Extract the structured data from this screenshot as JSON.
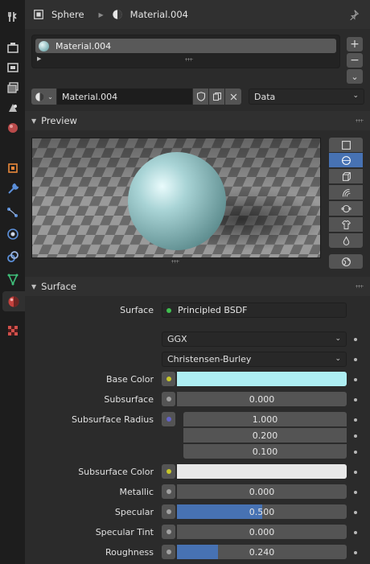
{
  "header": {
    "object_name": "Sphere",
    "material_name": "Material.004"
  },
  "slots": {
    "items": [
      "Material.004"
    ],
    "add_label": "+",
    "remove_label": "−",
    "more_label": "⌄"
  },
  "id_block": {
    "material_name": "Material.004",
    "link_mode": "Data"
  },
  "preview": {
    "title": "Preview",
    "shapes": [
      "plane-icon",
      "sphere-icon",
      "cube-icon",
      "hair-icon",
      "monkey-icon",
      "cloth-icon",
      "fluid-icon"
    ],
    "active_shape": "sphere-icon",
    "sphere_color": "#a9d4d6"
  },
  "surface": {
    "title": "Surface",
    "surface_label": "Surface",
    "shader": "Principled BSDF",
    "distribution": "GGX",
    "subsurface_method": "Christensen-Burley",
    "rows": [
      {
        "label": "Base Color",
        "type": "color",
        "socket": "#c7c729",
        "color": "#aeeef2"
      },
      {
        "label": "Subsurface",
        "type": "value",
        "socket": "#a1a1a1",
        "value": "0.000",
        "fraction": 0
      },
      {
        "label": "Subsurface Radius",
        "type": "vector",
        "socket": "#6363c7",
        "values": [
          "1.000",
          "0.200",
          "0.100"
        ]
      },
      {
        "label": "Subsurface Color",
        "type": "color",
        "socket": "#c7c729",
        "color": "#e8e8e8"
      },
      {
        "label": "Metallic",
        "type": "value",
        "socket": "#a1a1a1",
        "value": "0.000",
        "fraction": 0
      },
      {
        "label": "Specular",
        "type": "value",
        "socket": "#a1a1a1",
        "value": "0.500",
        "fraction": 0.5
      },
      {
        "label": "Specular Tint",
        "type": "value",
        "socket": "#a1a1a1",
        "value": "0.000",
        "fraction": 0
      },
      {
        "label": "Roughness",
        "type": "value",
        "socket": "#a1a1a1",
        "value": "0.240",
        "fraction": 0.24
      }
    ]
  },
  "colors": {
    "accent": "#4772b3",
    "active_tab": "#303030"
  }
}
